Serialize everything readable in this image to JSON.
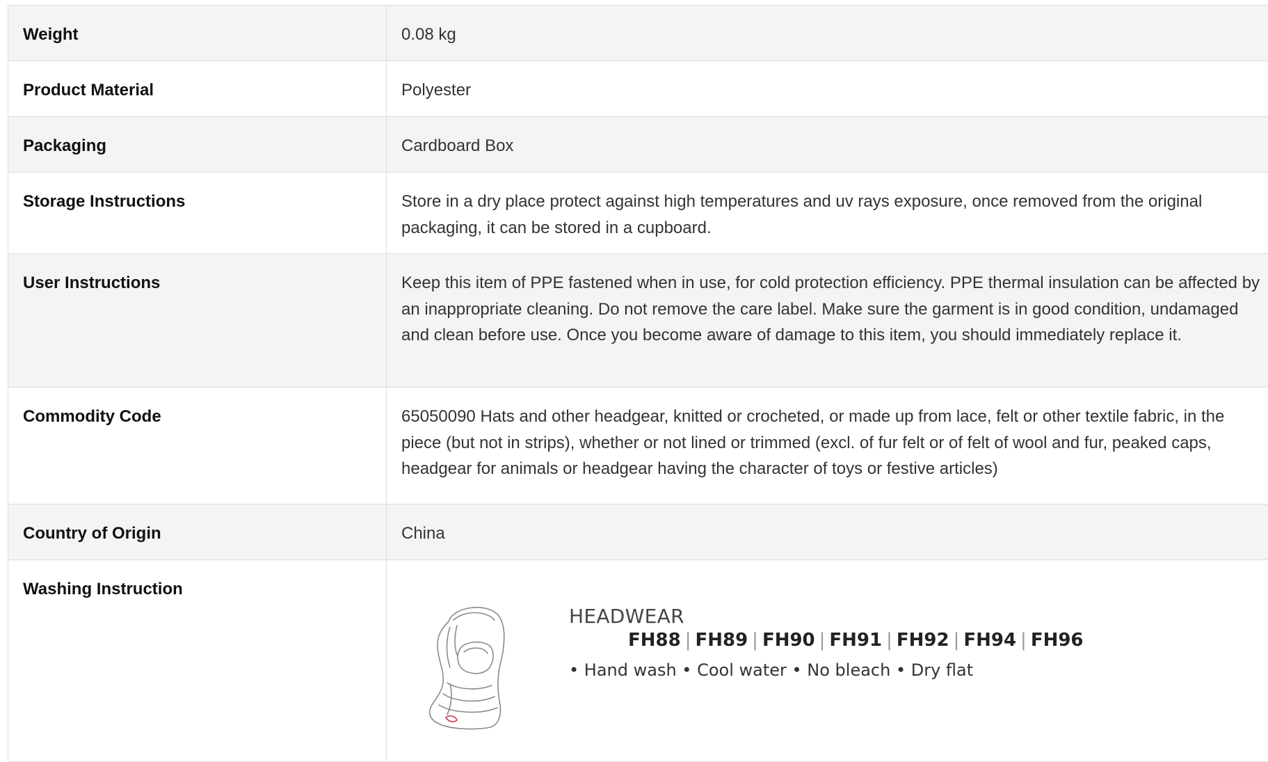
{
  "specs": [
    {
      "label": "Weight",
      "value": "0.08 kg"
    },
    {
      "label": "Product Material",
      "value": "Polyester"
    },
    {
      "label": "Packaging",
      "value": "Cardboard Box"
    },
    {
      "label": "Storage Instructions",
      "value": "Store in a dry place protect against high temperatures and uv rays exposure, once removed from the original packaging, it can be stored in a cupboard."
    },
    {
      "label": "User Instructions",
      "value": "Keep this item of PPE fastened when in use, for cold protection efficiency. PPE thermal insulation can be affected by an inappropriate cleaning. Do not remove the care label. Make sure the garment is in good condition, undamaged and clean before use. Once you become aware of damage to this item, you should immediately replace it."
    },
    {
      "label": "Commodity Code",
      "value": "65050090 Hats and other headgear, knitted or crocheted, or made up from lace, felt or other textile fabric, in the piece (but not in strips), whether or not lined or trimmed (excl. of fur felt or of felt of wool and fur, peaked caps, headgear for animals or headgear having the character of toys or festive articles)"
    },
    {
      "label": "Country of Origin",
      "value": "China"
    },
    {
      "label": "Washing Instruction"
    }
  ],
  "washing_label": {
    "heading": "HEADWEAR",
    "codes": [
      "FH88",
      "FH89",
      "FH90",
      "FH91",
      "FH92",
      "FH94",
      "FH96"
    ],
    "separator": "|",
    "steps": "• Hand wash • Cool water • No bleach • Dry flat",
    "illustration_icon": "balaclava-icon",
    "accent_color": "#cc3344"
  }
}
